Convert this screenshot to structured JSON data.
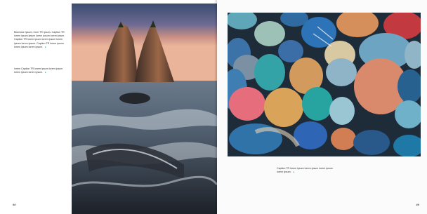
{
  "captions": {
    "left_top": "Bwrrwiue Ipsum, Cwrr TR Ipsum. Caption TR lorem ipsum ipsum lorem ipsum lorem ipsum. Caption TR lorem ipsum lorem ipsum lorem ipsum lorem ipsum. Caption TR lorem ipsum lorem ipsum lorem ipsum.",
    "left_bottom": "lorem Caption TR lorem ipsum lorem ipsum lorem ipsum lorem ipsum.",
    "right": "Caption TR lorem ipsum lorem ipsum lorem ipsum lorem ipsum."
  },
  "folios": {
    "left": "##",
    "right": "##"
  },
  "colors": {
    "accent": "#2aa7a0",
    "page": "#ffffff"
  }
}
